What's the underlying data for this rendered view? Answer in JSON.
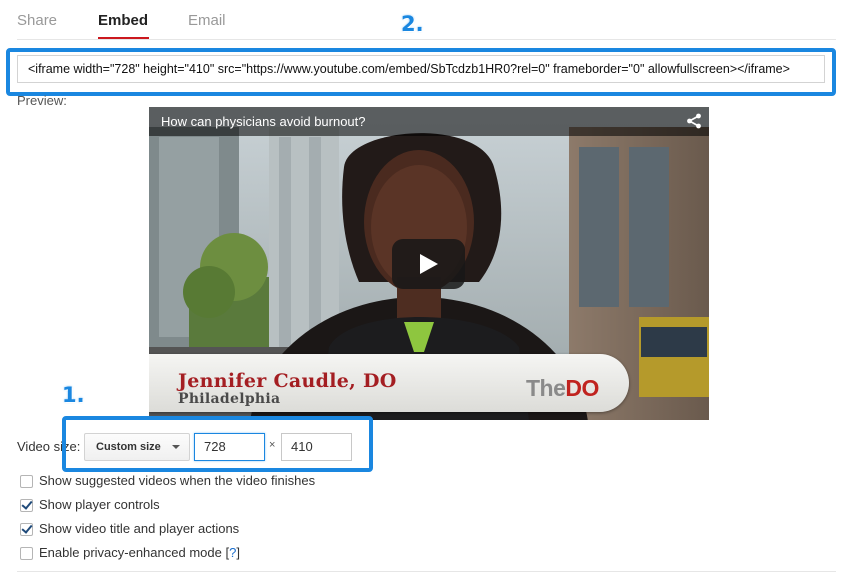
{
  "tabs": [
    {
      "label": "Share",
      "active": false
    },
    {
      "label": "Embed",
      "active": true
    },
    {
      "label": "Email",
      "active": false
    }
  ],
  "annotations": {
    "one": "1.",
    "two": "2."
  },
  "embed_code": "<iframe width=\"728\" height=\"410\" src=\"https://www.youtube.com/embed/SbTcdzb1HR0?rel=0\" frameborder=\"0\" allowfullscreen></iframe>",
  "preview": {
    "label": "Preview:",
    "video_title": "How can physicians avoid burnout?",
    "lower_third_name": "Jennifer Caudle, DO",
    "lower_third_place": "Philadelphia",
    "logo_the": "The",
    "logo_do": "DO",
    "icons": {
      "share": "share-icon",
      "play": "play-icon"
    }
  },
  "video_size": {
    "label": "Video size:",
    "selected": "Custom size",
    "width": "728",
    "height": "410",
    "separator": "×"
  },
  "options": [
    {
      "label": "Show suggested videos when the video finishes",
      "checked": false
    },
    {
      "label": "Show player controls",
      "checked": true
    },
    {
      "label": "Show video title and player actions",
      "checked": true
    },
    {
      "label": "Enable privacy-enhanced mode",
      "checked": false,
      "help": "?"
    }
  ],
  "colors": {
    "accent_red": "#cc181e",
    "annotation_blue": "#1a87e0",
    "logo_red": "#c0231f"
  }
}
